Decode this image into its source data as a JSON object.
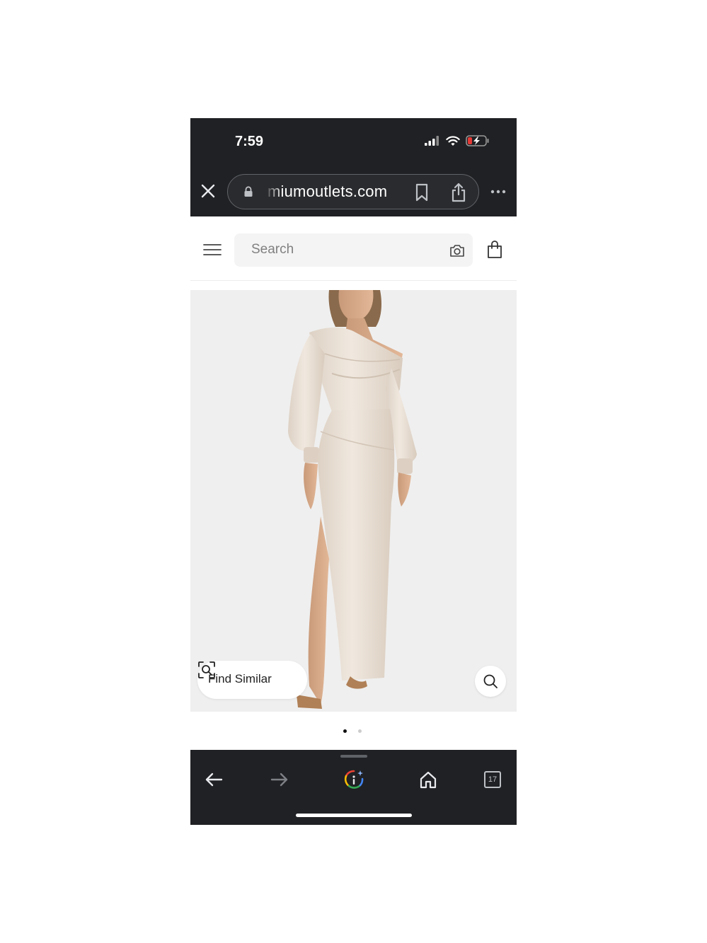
{
  "status_bar": {
    "time": "7:59"
  },
  "browser": {
    "url": "miumoutlets.com",
    "icons": {
      "close": "close-icon",
      "lock": "lock-icon",
      "bookmark": "bookmark-icon",
      "share": "share-icon",
      "more": "more-icon"
    }
  },
  "header": {
    "search_placeholder": "Search",
    "icons": {
      "menu": "hamburger-menu-icon",
      "camera": "camera-icon",
      "bag": "shopping-bag-icon"
    }
  },
  "product": {
    "find_similar_label": "Find Similar",
    "image_count": 2,
    "active_image_index": 0
  },
  "toolbar": {
    "tab_count": "17",
    "icons": [
      "back-arrow-icon",
      "forward-arrow-icon",
      "google-lens-icon",
      "home-icon",
      "tabs-icon"
    ]
  },
  "colors": {
    "chrome_bg": "#202124",
    "image_bg": "#efefef",
    "dress": "#e9dfd4"
  }
}
